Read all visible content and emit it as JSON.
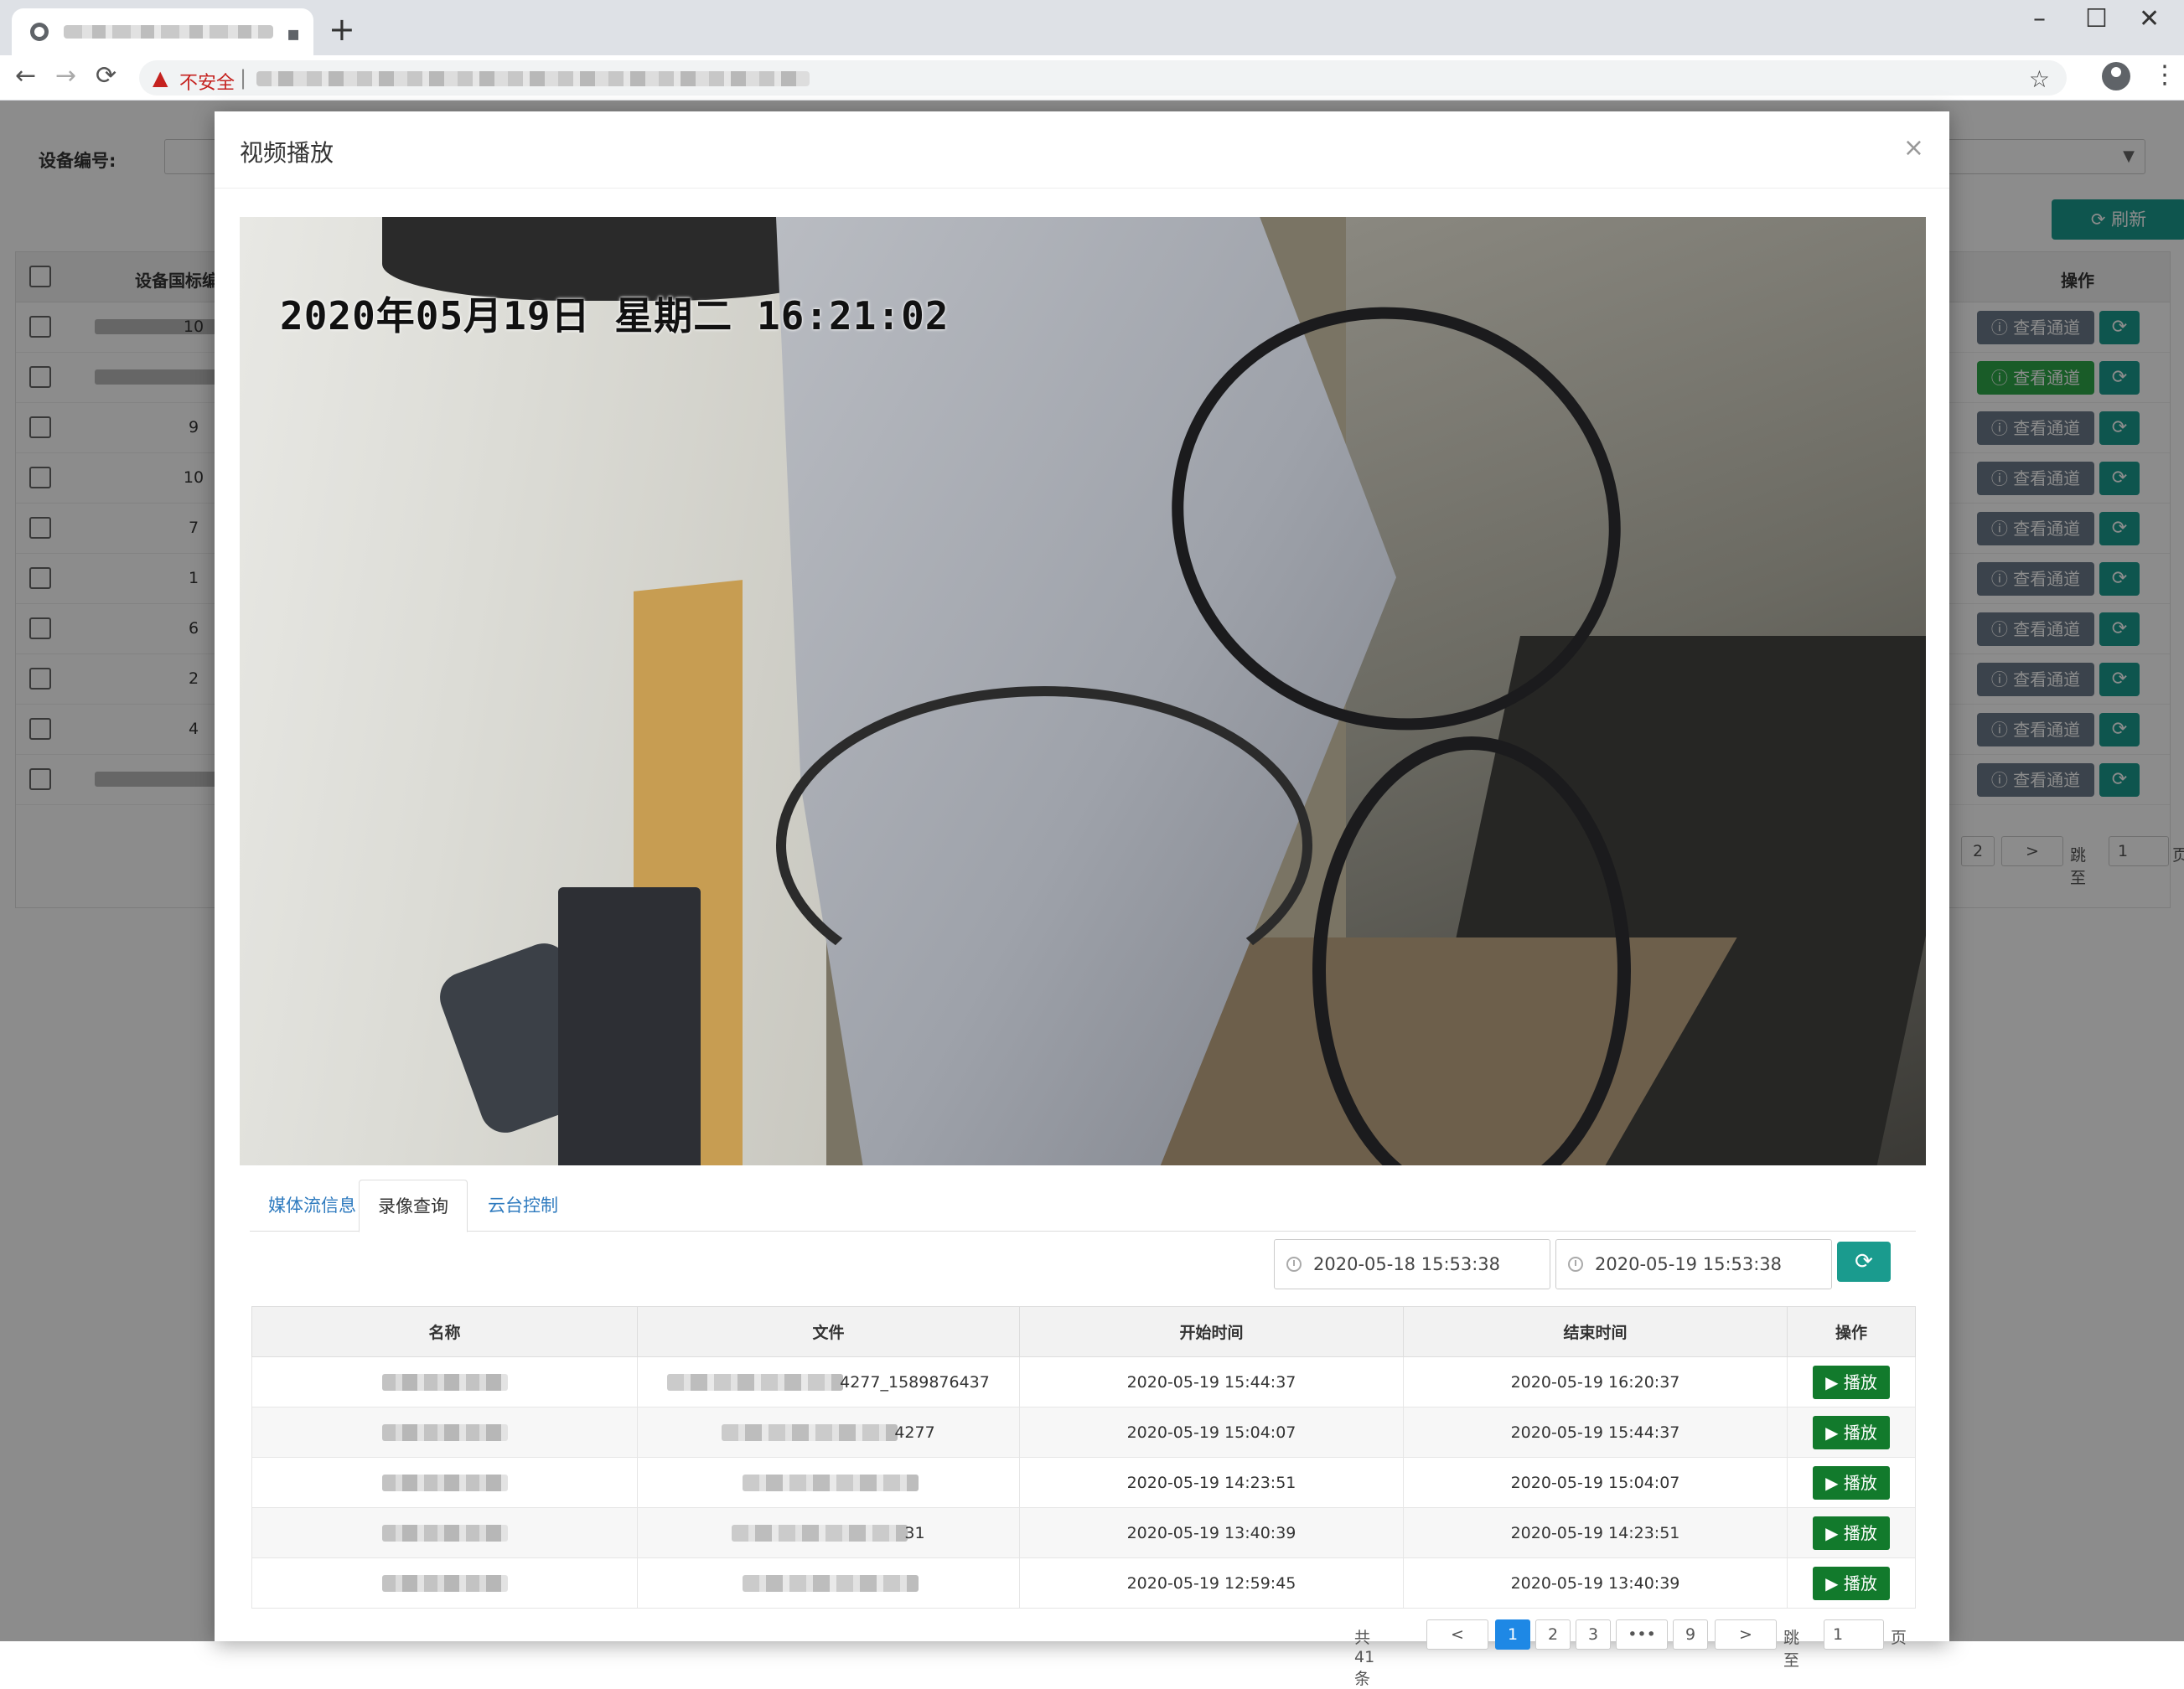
{
  "browser": {
    "new_tab_symbol": "+",
    "window_controls": [
      "–",
      "☐",
      "✕"
    ],
    "nav": {
      "back": "←",
      "forward": "→",
      "reload": "⟳"
    },
    "security_label": "不安全",
    "url_separator": "|"
  },
  "page": {
    "filter_label": "设备编号:",
    "refresh_label": "⟳ 刷新",
    "table_headers": {
      "device_id": "设备国标编号",
      "actions": "操作"
    },
    "rows": [
      {
        "num": "10",
        "blurred": true
      },
      {
        "num": "",
        "blurred": true
      },
      {
        "num": "9",
        "blurred": false
      },
      {
        "num": "10",
        "blurred": false
      },
      {
        "num": "7",
        "blurred": false
      },
      {
        "num": "1",
        "blurred": false
      },
      {
        "num": "6",
        "blurred": false
      },
      {
        "num": "2",
        "blurred": false
      },
      {
        "num": "4",
        "blurred": false
      },
      {
        "num": "",
        "blurred": true
      }
    ],
    "view_channel_label": "查看通道",
    "pager": {
      "page2": "2",
      "next": ">",
      "goto_label": "跳至",
      "goto_value": "1",
      "page_suffix": "页"
    }
  },
  "modal": {
    "title": "视频播放",
    "close": "×",
    "osd_text": "2020年05月19日  星期二  16:21:02",
    "tabs": [
      {
        "label": "媒体流信息",
        "active": false
      },
      {
        "label": "录像查询",
        "active": true
      },
      {
        "label": "云台控制",
        "active": false
      }
    ],
    "date_start": "2020-05-18 15:53:38",
    "date_end": "2020-05-19 15:53:38",
    "records": {
      "headers": [
        "名称",
        "文件",
        "开始时间",
        "结束时间",
        "操作"
      ],
      "rows": [
        {
          "file_tail": "4277_1589876437",
          "start": "2020-05-19 15:44:37",
          "end": "2020-05-19 16:20:37"
        },
        {
          "file_tail": "4277",
          "start": "2020-05-19 15:04:07",
          "end": "2020-05-19 15:44:37"
        },
        {
          "file_tail": "",
          "start": "2020-05-19 14:23:51",
          "end": "2020-05-19 15:04:07"
        },
        {
          "file_tail": "31",
          "start": "2020-05-19 13:40:39",
          "end": "2020-05-19 14:23:51"
        },
        {
          "file_tail": "",
          "start": "2020-05-19 12:59:45",
          "end": "2020-05-19 13:40:39"
        }
      ],
      "play_label": "▶ 播放"
    },
    "pager": {
      "total": "共 41 条",
      "prev": "<",
      "pages": [
        "1",
        "2",
        "3",
        "•••",
        "9"
      ],
      "current": "1",
      "next": ">",
      "goto_label": "跳至",
      "goto_value": "1",
      "page_suffix": "页"
    }
  },
  "colors": {
    "teal": "#1a9b8e",
    "play_green": "#127a2c",
    "active_green": "#2ea84a",
    "tab_link": "#2f7bbf",
    "pager_current": "#1e88e5",
    "insecure_red": "#c5221f"
  }
}
